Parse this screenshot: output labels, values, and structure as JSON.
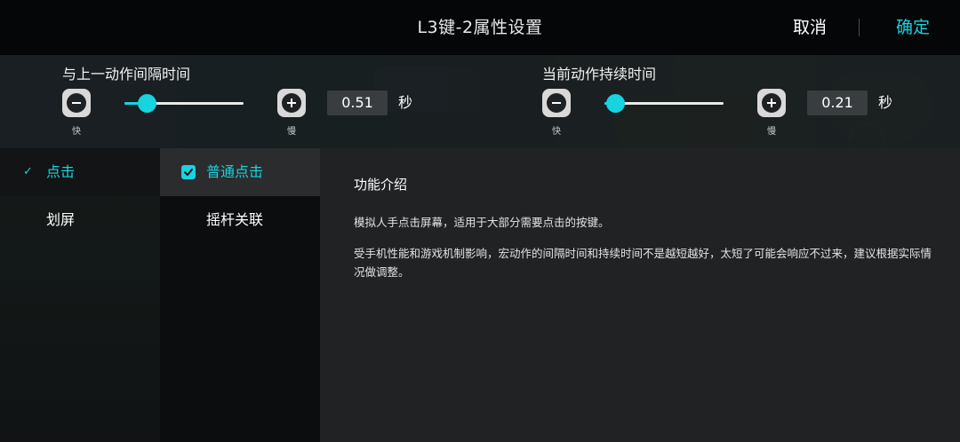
{
  "header": {
    "title": "L3键-2属性设置",
    "cancel_label": "取消",
    "confirm_label": "确定"
  },
  "timing": {
    "interval": {
      "label": "与上一动作间隔时间",
      "fast_label": "快",
      "slow_label": "慢",
      "value": "0.51",
      "unit": "秒",
      "slider_fraction": 0.19
    },
    "duration": {
      "label": "当前动作持续时间",
      "fast_label": "快",
      "slow_label": "慢",
      "value": "0.21",
      "unit": "秒",
      "slider_fraction": 0.09
    }
  },
  "action_types": [
    {
      "label": "点击",
      "selected": true,
      "check_icon": "✓"
    },
    {
      "label": "划屏",
      "selected": false
    }
  ],
  "action_subtypes": [
    {
      "label": "普通点击",
      "selected": true
    },
    {
      "label": "摇杆关联",
      "selected": false
    }
  ],
  "info": {
    "heading": "功能介绍",
    "paragraph1": "模拟人手点击屏幕，适用于大部分需要点击的按键。",
    "paragraph2": "受手机性能和游戏机制影响，宏动作的间隔时间和持续时间不是越短越好，太短了可能会响应不过来，建议根据实际情况做调整。"
  },
  "colors": {
    "accent": "#18d3e0",
    "header_bg": "#050607",
    "panel_bg": "#202223"
  }
}
